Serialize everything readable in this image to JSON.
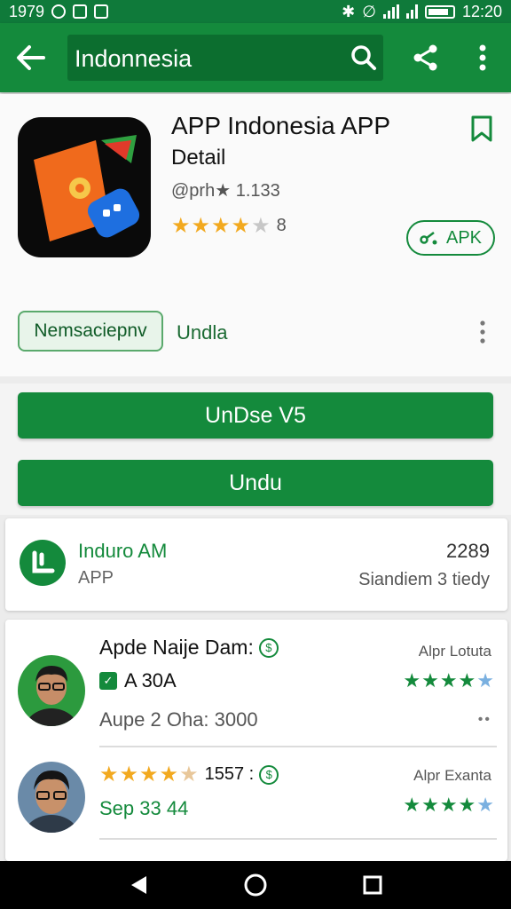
{
  "status_bar": {
    "time_left": "1979",
    "time_right": "12:20"
  },
  "app_bar": {
    "search_text": "Indonnesia",
    "icons": [
      "arrow-left-icon",
      "search-icon",
      "share-icon",
      "more-vert-icon"
    ]
  },
  "app": {
    "title": "APP Indonesia APP",
    "subtitle": "Detail",
    "meta": "@prh★ 1.133",
    "rating_stars": 4,
    "rating_count": "8",
    "apk_label": "APK",
    "chip_label": "Nemsaciepnv",
    "chip_side_label": "Undla"
  },
  "buttons": {
    "primary": "UnDse V5",
    "secondary": "Undu"
  },
  "source": {
    "name": "Induro AM",
    "sub": "APP",
    "count": "2289",
    "status": "Siandiem 3 tiedy"
  },
  "reviews": [
    {
      "title": "Apde Naije Dam:",
      "tag": "A 30A",
      "line": "Aupe 2 Oha: 3000",
      "source": "Alpr Lotuta",
      "stars": "★★★★",
      "dots": "••"
    },
    {
      "stars_text": "★★★★★",
      "count": "1557 :",
      "date": "Sep 33  44",
      "source": "Alpr Exanta",
      "stars": "★★★★"
    }
  ],
  "colors": {
    "primary": "#148a3c",
    "primary_dark": "#0f7a3a",
    "star": "#f2a91f"
  }
}
